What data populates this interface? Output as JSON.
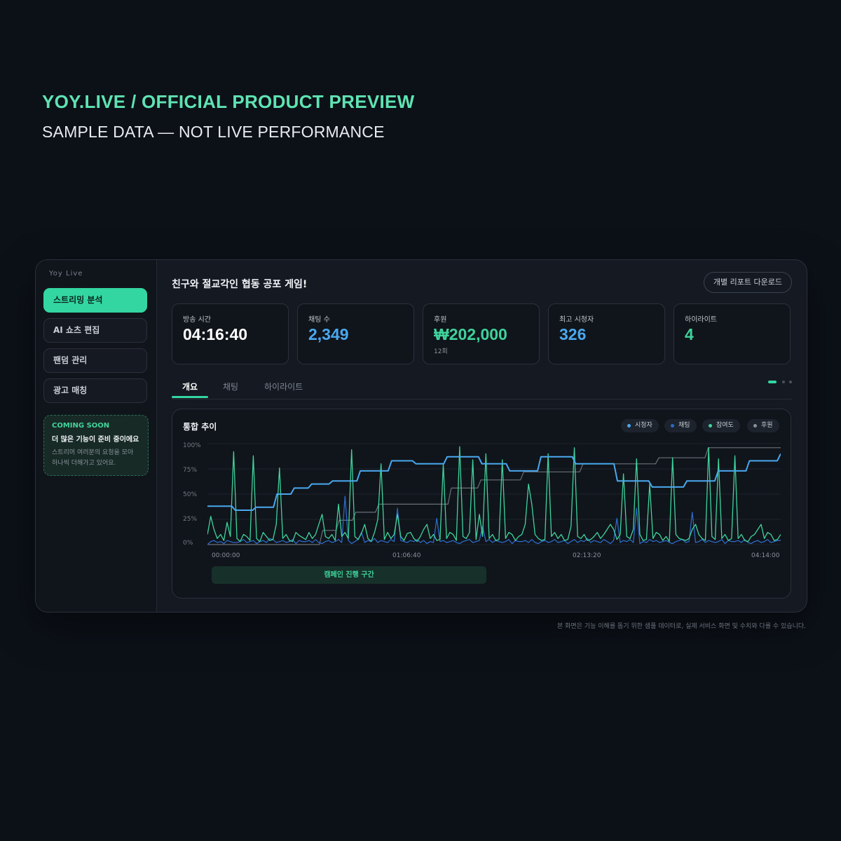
{
  "header": {
    "title": "YOY.LIVE / OFFICIAL PRODUCT PREVIEW",
    "subtitle": "SAMPLE DATA — NOT LIVE PERFORMANCE"
  },
  "sidebar": {
    "brand": "Yoy Live",
    "items": [
      {
        "label": "스트리밍 분석"
      },
      {
        "label": "AI 쇼츠 편집"
      },
      {
        "label": "팬덤 관리"
      },
      {
        "label": "광고 매칭"
      }
    ],
    "coming_soon": {
      "badge": "COMING SOON",
      "title": "더 많은 기능이 준비 중이에요",
      "body": "스트리머 여러분의 요청을 모아 하나씩 더해가고 있어요."
    }
  },
  "report": {
    "title": "친구와 절교각인 협동 공포 게임!",
    "download_label": "개별 리포트 다운로드"
  },
  "stats": [
    {
      "label": "방송 시간",
      "value": "04:16:40",
      "sub": "",
      "color": "#ffffff"
    },
    {
      "label": "채팅 수",
      "value": "2,349",
      "sub": "",
      "color": "#4aa8ef"
    },
    {
      "label": "후원",
      "value": "₩202,000",
      "sub": "12회",
      "color": "#3fd39b"
    },
    {
      "label": "최고 시청자",
      "value": "326",
      "sub": "",
      "color": "#4aa8ef"
    },
    {
      "label": "하이라이트",
      "value": "4",
      "sub": "",
      "color": "#3fd39b"
    }
  ],
  "tabs": [
    {
      "label": "개요",
      "active": true
    },
    {
      "label": "채팅",
      "active": false
    },
    {
      "label": "하이라이트",
      "active": false
    }
  ],
  "chart_card": {
    "campaign_label": "캠페인 진행 구간"
  },
  "chart_data": {
    "type": "line",
    "title": "통합 추이",
    "x_ticks": [
      "00:00:00",
      "01:06:40",
      "02:13:20",
      "04:14:00"
    ],
    "y_ticks": [
      "100%",
      "75%",
      "50%",
      "25%",
      "0%"
    ],
    "ylim": [
      0,
      100
    ],
    "grid": true,
    "legend_position": "top-right",
    "series": [
      {
        "name": "시청자",
        "color": "#4aa8ef",
        "values": [
          38,
          38,
          38,
          38,
          38,
          38,
          38,
          38,
          34,
          34,
          34,
          34,
          34,
          34,
          37,
          37,
          37,
          37,
          37,
          37,
          50,
          50,
          50,
          50,
          50,
          56,
          56,
          56,
          56,
          56,
          60,
          60,
          60,
          60,
          60,
          60,
          63,
          63,
          63,
          63,
          63,
          63,
          63,
          63,
          73,
          73,
          73,
          73,
          73,
          73,
          73,
          73,
          73,
          83,
          83,
          83,
          83,
          83,
          83,
          83,
          80,
          80,
          80,
          80,
          80,
          80,
          80,
          80,
          80,
          87,
          87,
          87,
          87,
          87,
          87,
          87,
          87,
          87,
          87,
          80,
          80,
          80,
          80,
          80,
          80,
          80,
          80,
          73,
          73,
          73,
          73,
          73,
          73,
          73,
          73,
          73,
          87,
          87,
          87,
          87,
          87,
          87,
          87,
          87,
          87,
          87,
          80,
          80,
          80,
          80,
          80,
          80,
          80,
          80,
          80,
          80,
          80,
          80,
          63,
          63,
          63,
          63,
          63,
          63,
          63,
          63,
          63,
          63,
          57,
          57,
          57,
          57,
          57,
          57,
          57,
          57,
          57,
          57,
          63,
          63,
          63,
          63,
          63,
          63,
          63,
          63,
          63,
          73,
          73,
          73,
          73,
          73,
          73,
          73,
          73,
          73,
          83,
          83,
          83,
          83,
          83,
          83,
          83,
          83,
          83,
          90
        ]
      },
      {
        "name": "채팅",
        "color": "#2d69c4",
        "values": [
          0,
          3,
          4,
          2,
          3,
          1,
          4,
          3,
          2,
          2,
          3,
          5,
          2,
          3,
          4,
          1,
          3,
          4,
          2,
          6,
          5,
          2,
          3,
          4,
          2,
          3,
          5,
          1,
          4,
          3,
          3,
          4,
          2,
          5,
          2,
          1,
          3,
          4,
          2,
          3,
          5,
          2,
          3,
          4,
          1,
          3,
          5,
          12,
          2,
          4,
          3,
          6,
          2,
          4,
          3,
          2,
          5,
          3,
          1,
          4,
          3,
          2,
          4,
          3,
          5,
          2,
          4,
          1,
          3,
          2,
          5,
          3,
          4,
          2,
          3,
          4,
          2,
          1,
          3,
          4,
          5,
          2,
          3,
          4,
          2,
          3,
          5,
          2,
          4,
          3,
          2,
          3,
          5,
          1,
          4,
          3,
          3,
          4,
          2,
          5,
          2,
          1,
          3,
          4,
          2,
          3,
          5,
          2,
          3,
          4,
          1,
          3,
          5,
          2,
          4,
          3,
          6,
          2,
          4,
          3,
          2,
          5,
          3,
          1,
          4,
          3,
          2,
          4,
          3,
          5,
          2,
          4,
          1,
          3,
          2,
          5,
          3,
          4,
          2,
          3,
          4,
          2,
          1,
          3,
          4,
          5,
          2,
          3,
          4,
          2,
          3,
          5,
          2,
          4,
          3,
          2,
          3,
          5,
          1,
          4,
          3,
          3,
          4,
          2,
          5,
          2,
          1,
          3,
          4,
          2,
          3,
          5,
          2,
          3,
          4,
          4
        ],
        "spikes": {
          "42": 48,
          "58": 36,
          "70": 26,
          "84": 18,
          "125": 26,
          "131": 36,
          "148": 32
        }
      },
      {
        "name": "참여도",
        "color": "#3fd39b",
        "values": [
          10,
          28,
          15,
          6,
          10,
          4,
          22,
          8,
          92,
          6,
          3,
          10,
          8,
          4,
          88,
          6,
          3,
          12,
          8,
          4,
          5,
          20,
          76,
          6,
          10,
          4,
          3,
          12,
          9,
          7,
          5,
          12,
          6,
          10,
          20,
          30,
          8,
          6,
          10,
          4,
          40,
          8,
          12,
          6,
          94,
          8,
          5,
          11,
          20,
          6,
          3,
          12,
          25,
          80,
          5,
          12,
          6,
          10,
          30,
          8,
          4,
          11,
          12,
          6,
          3,
          8,
          15,
          20,
          6,
          10,
          4,
          5,
          80,
          6,
          12,
          10,
          4,
          97,
          8,
          6,
          12,
          84,
          5,
          30,
          8,
          90,
          6,
          10,
          4,
          5,
          84,
          6,
          12,
          10,
          4,
          8,
          10,
          20,
          60,
          40,
          10,
          6,
          4,
          5,
          90,
          8,
          12,
          6,
          10,
          4,
          5,
          18,
          96,
          8,
          6,
          10,
          4,
          5,
          8,
          12,
          6,
          10,
          15,
          20,
          15,
          5,
          10,
          70,
          8,
          6,
          15,
          85,
          10,
          4,
          5,
          60,
          6,
          12,
          10,
          4,
          8,
          3,
          86,
          10,
          6,
          5,
          4,
          6,
          15,
          20,
          10,
          6,
          4,
          96,
          8,
          5,
          85,
          6,
          10,
          4,
          6,
          88,
          6,
          10,
          4,
          3,
          8,
          10,
          15,
          20,
          6,
          12,
          10,
          4,
          5,
          10
        ]
      },
      {
        "name": "후원",
        "color": "#6b7079",
        "values": [
          0,
          0,
          0,
          0,
          0,
          0,
          0,
          0,
          0,
          0,
          0,
          0,
          0,
          0,
          0,
          0,
          0,
          0,
          0,
          0,
          0,
          0,
          0,
          0,
          0,
          0,
          0,
          0,
          0,
          0,
          0,
          0,
          0,
          0,
          0,
          14,
          14,
          14,
          14,
          14,
          24,
          24,
          24,
          24,
          24,
          32,
          32,
          32,
          32,
          32,
          32,
          32,
          40,
          40,
          40,
          40,
          40,
          40,
          40,
          40,
          40,
          40,
          40,
          40,
          40,
          40,
          40,
          40,
          40,
          40,
          40,
          40,
          40,
          40,
          56,
          56,
          56,
          56,
          56,
          56,
          56,
          56,
          56,
          64,
          64,
          64,
          64,
          64,
          64,
          64,
          64,
          64,
          64,
          64,
          64,
          64,
          72,
          72,
          72,
          72,
          72,
          72,
          72,
          72,
          72,
          72,
          72,
          72,
          72,
          72,
          72,
          72,
          72,
          72,
          80,
          80,
          80,
          80,
          80,
          80,
          80,
          80,
          80,
          80,
          80,
          80,
          80,
          80,
          80,
          80,
          80,
          80,
          80,
          80,
          80,
          80,
          80,
          86,
          86,
          86,
          86,
          86,
          86,
          86,
          86,
          86,
          86,
          86,
          86,
          86,
          86,
          86,
          96,
          96,
          96,
          96,
          96,
          96,
          96,
          96,
          96,
          96,
          96,
          96,
          96,
          96,
          96,
          96,
          96,
          96,
          96,
          96,
          96,
          96,
          96
        ]
      }
    ]
  },
  "footnote": "본 화면은 기능 이해를 돕기 위한 샘플 데이터로, 실제 서비스 화면 및 수치와 다를 수 있습니다."
}
